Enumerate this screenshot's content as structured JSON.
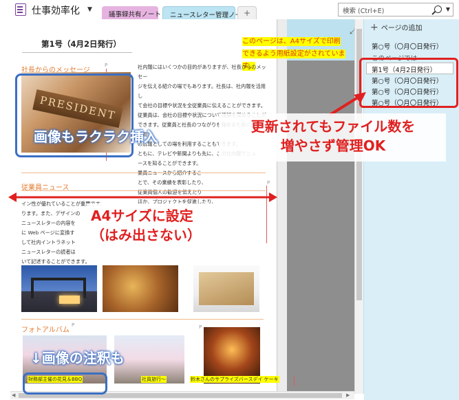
{
  "header": {
    "notebook_title": "仕事効率化",
    "tabs": [
      "議事録共有ノート",
      "ニュースレター管理ノート",
      "+"
    ],
    "search_placeholder": "検索 (Ctrl+E)"
  },
  "page": {
    "title": "第1号（4月2日発行）",
    "yellow_note_line1": "このページは、A4サイズで印刷",
    "yellow_note_line2": "できるよう用紙設定がされています。",
    "sections": {
      "president": "社長からのメッセージ",
      "employees": "従業員ニュース",
      "photo_album": "フォトアルバム"
    },
    "president_image_text": "PRESIDENT",
    "president_text": [
      "社内報にはいくつかの目的がありますが、社長からのメッセー",
      "ジを伝える紹介の場でもあります。社長は、社内報を活用し",
      "て会社の目標や状況を全従業員に伝えることができます。",
      "従業員は、会社の目標や状況について理解を深めることが",
      "できます。従業員と社長のつながりを強めるために、回覧応用",
      "の広報としての場を利用することもできます。",
      "ともに、テレビや新聞よりも先に、この社内報でニュ",
      "ースを知ることができます。",
      "業員ニュースから紹介するこ",
      "とで、その業績を表彰したり、",
      "従業員個人の歓迎を伝えたり",
      "ほか、プロジェクトを促進したり、",
      "りません。"
    ],
    "employee_text": [
      "イン性が優れていることが重要です。",
      "ります。また、デザインの",
      "ニュースレターの内容を",
      "に Web ページに変換す",
      "して社内イントラネット",
      "ニュースレターの読者は",
      "いて記述することができます。"
    ],
    "captions": [
      "財務部主催の花見＆BBQ",
      "社員旅行～",
      "鈴木さんのサプライズバースデイ ケーキ"
    ]
  },
  "sidebar": {
    "add_page": "ページの追加",
    "pages": [
      "第○号（〇月〇日発行）",
      "このページでは",
      "第1号（4月2日発行）",
      "第○号（〇月〇日発行）",
      "第○号（〇月〇日発行）",
      "第○号（〇月〇日発行）"
    ]
  },
  "annotations": {
    "image_insert": "画像もラクラク挿入",
    "update_line1": "更新されてもファイル数を",
    "update_line2": "増やさず管理OK",
    "a4_line1": "A4サイズに設定",
    "a4_line2": "（はみ出さない）",
    "caption_note": "↓画像の注釈も"
  },
  "colors": {
    "annotation_blue": "#3a6fc4",
    "annotation_red": "#e02020",
    "section_orange": "#e37a2d",
    "sidebar_bg": "#d9eef7",
    "tab_pink": "#e6b3e0",
    "tab_blue": "#bce4f2"
  }
}
